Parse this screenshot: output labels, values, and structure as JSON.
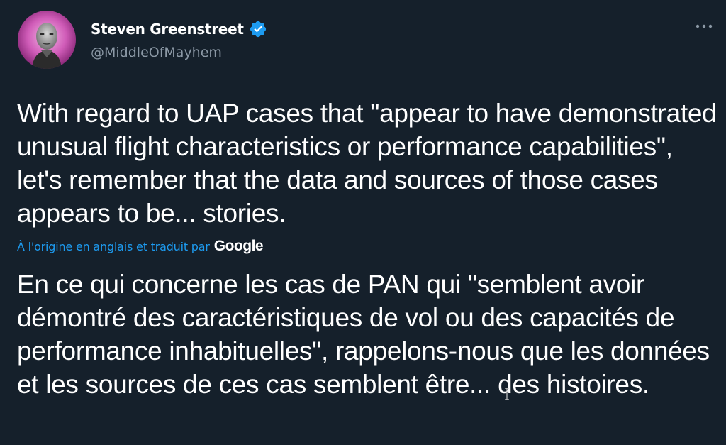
{
  "author": {
    "display_name": "Steven Greenstreet",
    "handle": "@MiddleOfMayhem",
    "verified_icon": "verified-badge-icon",
    "avatar": "avatar-photo"
  },
  "menu": {
    "icon": "more-options-icon"
  },
  "tweet": {
    "text": "With regard to UAP cases that \"appear to have demonstrated unusual flight characteristics or performance capabilities\", let's remember that the data and sources of those cases appears to be... stories."
  },
  "translation": {
    "attribution": "À l'origine en anglais et traduit par",
    "provider": "Google",
    "text": "En ce qui concerne les cas de PAN qui \"semblent avoir démontré des caractéristiques de vol ou des capacités de performance inhabituelles\", rappelons-nous que les données et les sources de ces cas semblent être... des histoires."
  },
  "colors": {
    "background": "#15202b",
    "text_primary": "#ffffff",
    "text_secondary": "#8b98a5",
    "accent": "#1d9bf0"
  }
}
